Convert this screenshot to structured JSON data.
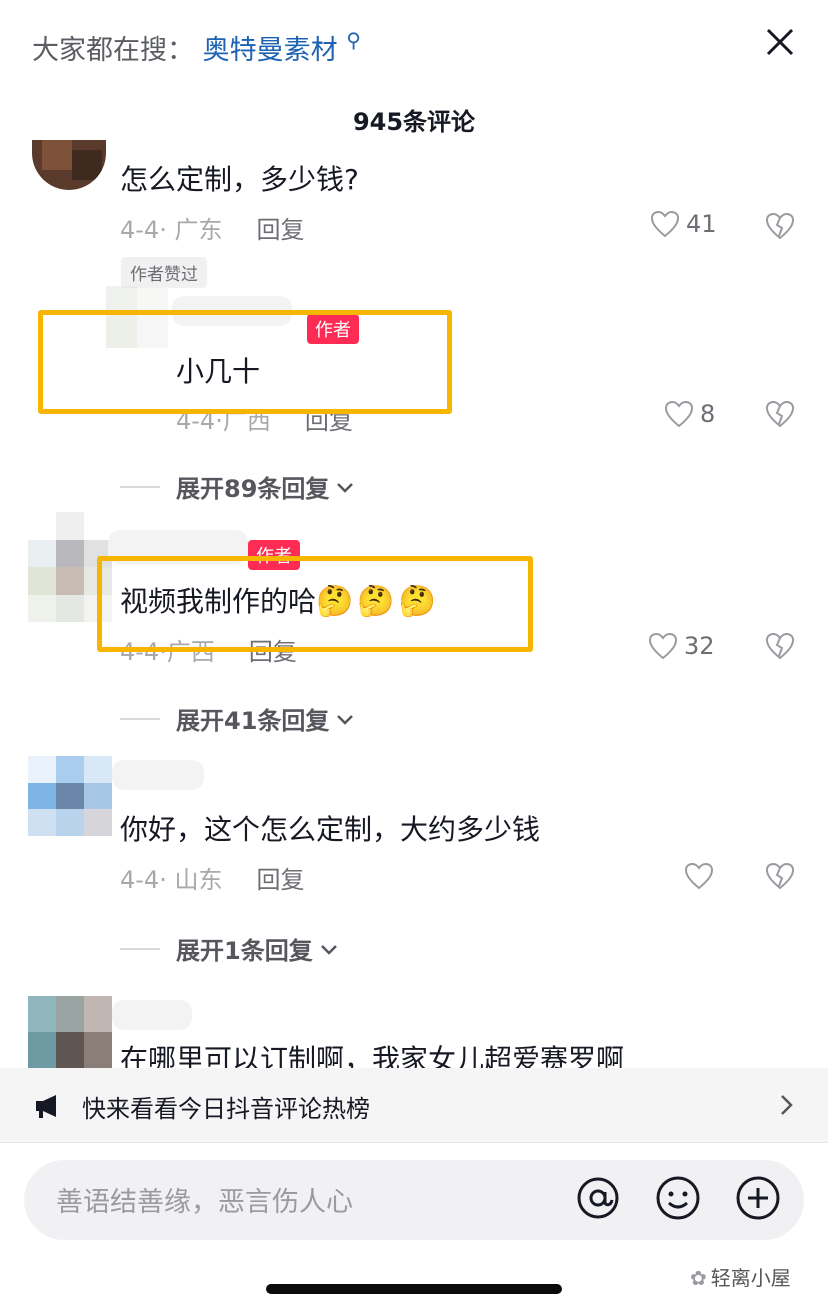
{
  "header": {
    "search_prefix": "大家都在搜：",
    "search_keyword": "奥特曼素材",
    "comment_count_title": "945条评论"
  },
  "comments": [
    {
      "text": "怎么定制，多少钱?",
      "date_location": "4-4· 广东",
      "reply_label": "回复",
      "likes": "41",
      "liked_by_author": "作者赞过"
    },
    {
      "author_badge": "作者",
      "text": "小几十",
      "date_location": "4-4·广西",
      "reply_label": "回复",
      "likes": "8",
      "expand_label": "展开89条回复"
    },
    {
      "author_badge": "作者",
      "text": "视频我制作的哈",
      "emoji": "🤔🤔🤔",
      "date_location": "4-4·广西",
      "reply_label": "回复",
      "likes": "32",
      "expand_label": "展开41条回复"
    },
    {
      "text": "你好，这个怎么定制，大约多少钱",
      "date_location": "4-4· 山东",
      "reply_label": "回复",
      "likes": "",
      "expand_label": "展开1条回复"
    },
    {
      "text": "在哪里可以订制啊，我家女儿超爱赛罗啊"
    }
  ],
  "hot_list": {
    "text": "快来看看今日抖音评论热榜"
  },
  "input": {
    "placeholder": "善语结善缘，恶言伤人心"
  },
  "watermark": "轻离小屋",
  "colors": {
    "highlight": "#f7b500",
    "author_badge": "#fe2c55",
    "link": "#1e62b3"
  }
}
